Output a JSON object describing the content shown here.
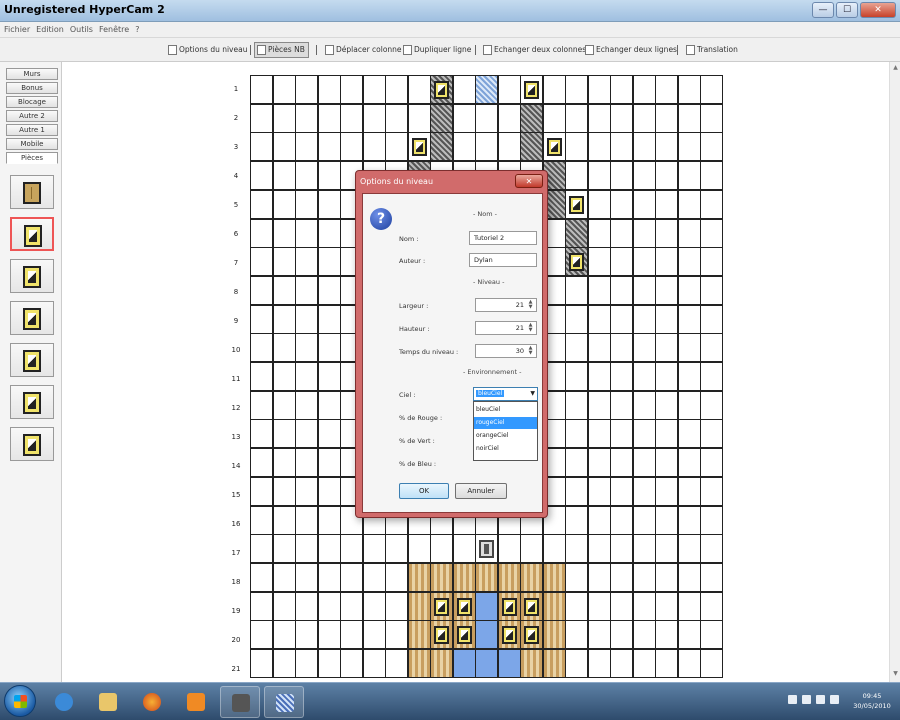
{
  "window": {
    "title": "Unregistered HyperCam 2",
    "minimize_glyph": "—",
    "maximize_glyph": "☐",
    "close_glyph": "✕"
  },
  "menu": [
    "Fichier",
    "Edition",
    "Outils",
    "Fenêtre",
    "?"
  ],
  "toolbar": {
    "options_niveau": "Options du niveau",
    "pieces_nb": "Pièces NB",
    "deplacer_colonne": "Déplacer colonne",
    "dupliquer_ligne": "Dupliquer ligne",
    "echanger_colonnes": "Echanger deux colonnes",
    "echanger_lignes": "Echanger deux lignes",
    "translation": "Translation"
  },
  "left_tabs": [
    "Murs",
    "Bonus",
    "Blocage",
    "Autre 2",
    "Autre 1",
    "Mobile",
    "Pièces"
  ],
  "pieces_count": 7,
  "row_numbers": [
    "1",
    "2",
    "3",
    "4",
    "5",
    "6",
    "7",
    "8",
    "9",
    "10",
    "11",
    "12",
    "13",
    "14",
    "15",
    "16",
    "17",
    "18",
    "19",
    "20",
    "21"
  ],
  "dialog": {
    "title": "Options du niveau",
    "close_glyph": "✕",
    "icon": "question-icon",
    "section_nom": "- Nom -",
    "nom_label": "Nom :",
    "nom_value": "Tutoriel 2",
    "auteur_label": "Auteur :",
    "auteur_value": "Dylan",
    "section_niveau": "- Niveau -",
    "largeur_label": "Largeur :",
    "largeur_value": "21",
    "hauteur_label": "Hauteur :",
    "hauteur_value": "21",
    "temps_label": "Temps du niveau :",
    "temps_value": "30",
    "section_env": "- Environnement -",
    "ciel_label": "Ciel :",
    "ciel_value": "bleuCiel",
    "rouge_label": "% de Rouge :",
    "vert_label": "% de Vert :",
    "bleu_label": "% de Bleu :",
    "ciel_options": [
      "bleuCiel",
      "rougeCiel",
      "orangeCiel",
      "noirCiel"
    ],
    "ciel_highlight_index": 1,
    "ok_label": "OK",
    "cancel_label": "Annuler"
  },
  "taskbar": {
    "time": "09:45",
    "date": "30/05/2010",
    "apps": [
      "internet-explorer",
      "file-explorer",
      "firefox",
      "media-player",
      "game-editor",
      "hypercam"
    ]
  },
  "colors": {
    "dialog_frame": "#d16b6b",
    "tile_yellow": "#f0e36a",
    "floor_blue": "#7ca6e8",
    "floor_tan": "#c89e5f"
  }
}
